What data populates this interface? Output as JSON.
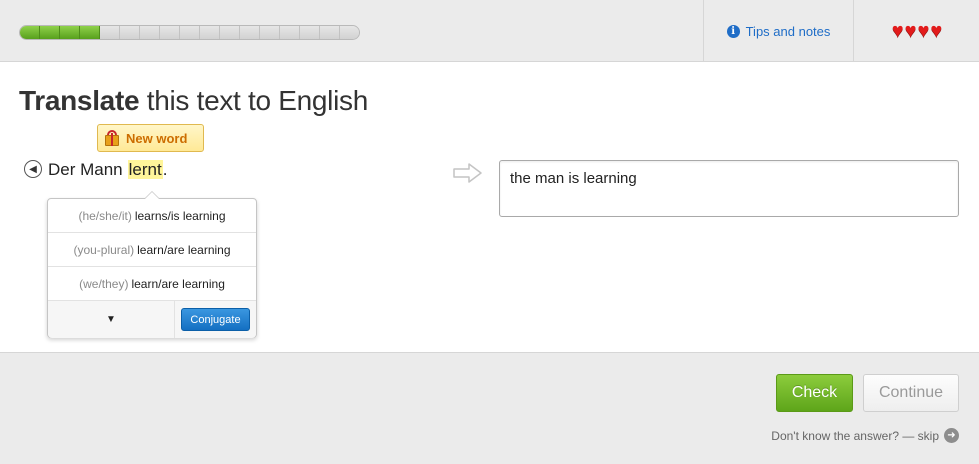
{
  "progress": {
    "segments_total": 17,
    "segments_filled": 4,
    "fill_color": "#6cb82a"
  },
  "header": {
    "tips_label": "Tips and notes",
    "tips_icon": "info-icon",
    "hearts_count": 4,
    "heart_glyph": "♥",
    "heart_color": "#e21b1b"
  },
  "title": {
    "bold": "Translate",
    "rest": "this text to English"
  },
  "badge": {
    "label": "New word",
    "icon": "gift-icon"
  },
  "sentence": {
    "before": "Der Mann",
    "highlight": "lernt",
    "after": "."
  },
  "dropdown": {
    "rows": [
      {
        "pronoun": "(he/she/it)",
        "translation": "learns/is learning"
      },
      {
        "pronoun": "(you-plural)",
        "translation": "learn/are learning"
      },
      {
        "pronoun": "(we/they)",
        "translation": "learn/are learning"
      }
    ],
    "more_glyph": "▼",
    "conjugate_label": "Conjugate"
  },
  "answer": {
    "value": "the man is learning"
  },
  "footer": {
    "check_label": "Check",
    "continue_label": "Continue",
    "skip_text": "Don't know the answer? — skip"
  },
  "colors": {
    "accent_blue": "#1f6dc7",
    "check_green": "#6cb82a",
    "highlight": "#fff59a"
  }
}
